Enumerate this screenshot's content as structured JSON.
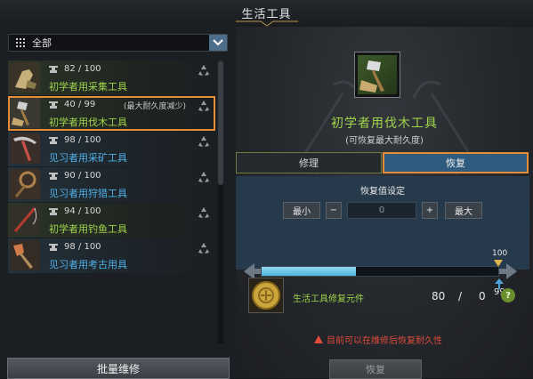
{
  "window": {
    "title": "生活工具"
  },
  "filter": {
    "selected": "全部"
  },
  "tools": [
    {
      "durability": "82 / 100",
      "name": "初学者用采集工具",
      "grade": "green",
      "note": "",
      "icon": "gathering-tool-icon"
    },
    {
      "durability": "40 / 99",
      "name": "初学者用伐木工具",
      "grade": "green",
      "note": "(最大耐久度减少)",
      "icon": "logging-axe-icon",
      "selected": true
    },
    {
      "durability": "98 / 100",
      "name": "见习者用采矿工具",
      "grade": "blue",
      "note": "",
      "icon": "mining-pick-icon"
    },
    {
      "durability": "90 / 100",
      "name": "见习者用狩猎工具",
      "grade": "blue",
      "note": "",
      "icon": "hunting-tool-icon"
    },
    {
      "durability": "94 / 100",
      "name": "初学者用钓鱼工具",
      "grade": "green",
      "note": "",
      "icon": "fishing-rod-icon"
    },
    {
      "durability": "98 / 100",
      "name": "见习者用考古用具",
      "grade": "blue",
      "note": "",
      "icon": "archaeology-shovel-icon"
    }
  ],
  "batch_repair_label": "批量维修",
  "detail": {
    "item_name": "初学者用伐木工具",
    "item_sub": "(可恢复最大耐久度)",
    "tabs": [
      {
        "label": "修理"
      },
      {
        "label": "恢复",
        "active": true
      }
    ]
  },
  "restore": {
    "title": "恢复值设定",
    "min_label": "最小",
    "minus": "−",
    "value": "0",
    "plus": "+",
    "max_label": "最大",
    "slider_max": "100",
    "slider_current": "99",
    "slider_fill_fraction": 0.4
  },
  "material": {
    "name": "生活工具修复元件",
    "have": "80",
    "separator": "/",
    "need": "0",
    "help": "?"
  },
  "warning": "目前可以在维修后恢复耐久性",
  "restore_button": "恢复",
  "colors": {
    "highlight": "#e68c37",
    "grade_green": "#9fd44b",
    "grade_blue": "#4fb0e6",
    "warning": "#e04b3c"
  }
}
